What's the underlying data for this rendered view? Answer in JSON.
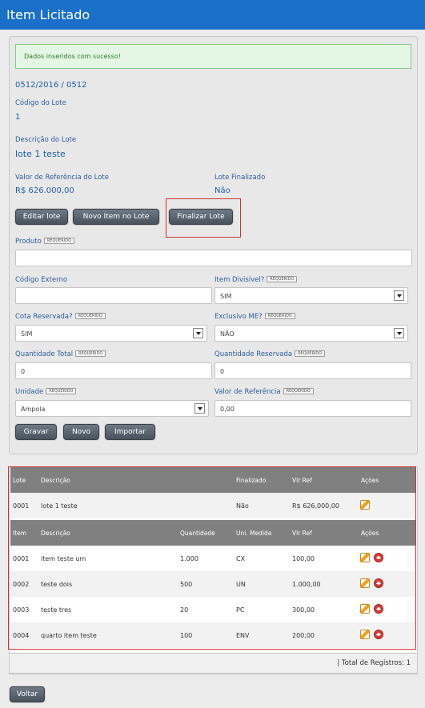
{
  "window": {
    "title": "Item Licitado"
  },
  "alert": {
    "message": "Dados inseridos com sucesso!"
  },
  "lote_info": {
    "process": "0512/2016 / 0512",
    "codigo_label": "Código do Lote",
    "codigo_value": "1",
    "descricao_label": "Descrição do Lote",
    "descricao_value": "lote 1 teste",
    "valor_label": "Valor de Referência do Lote",
    "valor_value": "R$ 626.000,00",
    "finalizado_label": "Lote Finalizado",
    "finalizado_value": "Não"
  },
  "actions": {
    "editar": "Editar lote",
    "novo_item": "Novo Item no Lote",
    "finalizar": "Finalizar Lote"
  },
  "required_tag": "REQUERIDO",
  "form": {
    "produto_label": "Produto",
    "produto_value": "",
    "codigo_externo_label": "Código Externo",
    "codigo_externo_value": "",
    "item_divisivel_label": "Item Divisível?",
    "item_divisivel_value": "SIM",
    "cota_label": "Cota Reservada?",
    "cota_value": "SIM",
    "exclusivo_label": "Exclusivo ME?",
    "exclusivo_value": "NÃO",
    "qtd_total_label": "Quantidade Total",
    "qtd_total_value": "0",
    "qtd_reservada_label": "Quantidade Reservada",
    "qtd_reservada_value": "0",
    "unidade_label": "Unidade",
    "unidade_value": "Ampola",
    "valor_ref_label": "Valor de Referência",
    "valor_ref_value": "0,00"
  },
  "form_buttons": {
    "gravar": "Gravar",
    "novo": "Novo",
    "importar": "Importar"
  },
  "lote_table": {
    "headers": [
      "Lote",
      "Descrição",
      "Finalizado",
      "Vlr Ref",
      "Ações"
    ],
    "row": [
      "0001",
      "lote 1 teste",
      "Não",
      "R$ 626.000,00"
    ]
  },
  "items_table": {
    "headers": [
      "Item",
      "Descrição",
      "Quantidade",
      "Uni. Medida",
      "Vlr Ref",
      "Ações"
    ],
    "rows": [
      [
        "0001",
        "item teste um",
        "1.000",
        "CX",
        "100,00"
      ],
      [
        "0002",
        "teste dois",
        "500",
        "UN",
        "1.000,00"
      ],
      [
        "0003",
        "teste tres",
        "20",
        "PC",
        "300,00"
      ],
      [
        "0004",
        "quarto item teste",
        "100",
        "ENV",
        "200,00"
      ]
    ]
  },
  "footer": {
    "total": "| Total de Registros: 1"
  },
  "back_button": "Voltar"
}
